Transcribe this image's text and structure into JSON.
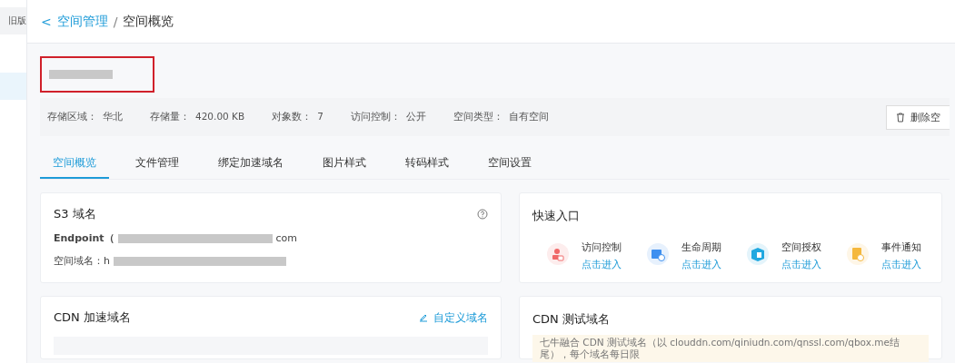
{
  "sidebar": {
    "items": [
      {
        "label": "旧版"
      }
    ]
  },
  "breadcrumb": {
    "back": "<",
    "parent": "空间管理",
    "separator": "/",
    "current": "空间概览"
  },
  "info": [
    {
      "label": "存储区域：",
      "value": "华北"
    },
    {
      "label": "存储量：",
      "value": "420.00 KB"
    },
    {
      "label": "对象数：",
      "value": "7"
    },
    {
      "label": "访问控制：",
      "value": "公开"
    },
    {
      "label": "空间类型：",
      "value": "自有空间"
    }
  ],
  "delete_button": "删除空",
  "tabs": [
    {
      "label": "空间概览",
      "selected": true
    },
    {
      "label": "文件管理",
      "selected": false
    },
    {
      "label": "绑定加速域名",
      "selected": false
    },
    {
      "label": "图片样式",
      "selected": false
    },
    {
      "label": "转码样式",
      "selected": false
    },
    {
      "label": "空间设置",
      "selected": false
    }
  ],
  "s3_card": {
    "title": "S3 域名",
    "rows": [
      {
        "label": "Endpoint（",
        "tail": "com"
      },
      {
        "label": "空间域名：h",
        "tail": ""
      }
    ]
  },
  "quick_card": {
    "title": "快速入口",
    "items": [
      {
        "kind": "access",
        "label": "访问控制",
        "link": "点击进入",
        "color": "#f06a6a"
      },
      {
        "kind": "lifecycle",
        "label": "生命周期",
        "link": "点击进入",
        "color": "#3d8ff0"
      },
      {
        "kind": "auth",
        "label": "空间授权",
        "link": "点击进入",
        "color": "#20a8e0"
      },
      {
        "kind": "event",
        "label": "事件通知",
        "link": "点击进入",
        "color": "#f5b83d"
      }
    ]
  },
  "cdn_card": {
    "title": "CDN 加速域名",
    "action": "自定义域名"
  },
  "cdn_test_card": {
    "title": "CDN 测试域名",
    "notice": "七牛融合 CDN 测试域名（以 clouddn.com/qiniudn.com/qnssl.com/qbox.me结尾），每个域名每日限"
  }
}
